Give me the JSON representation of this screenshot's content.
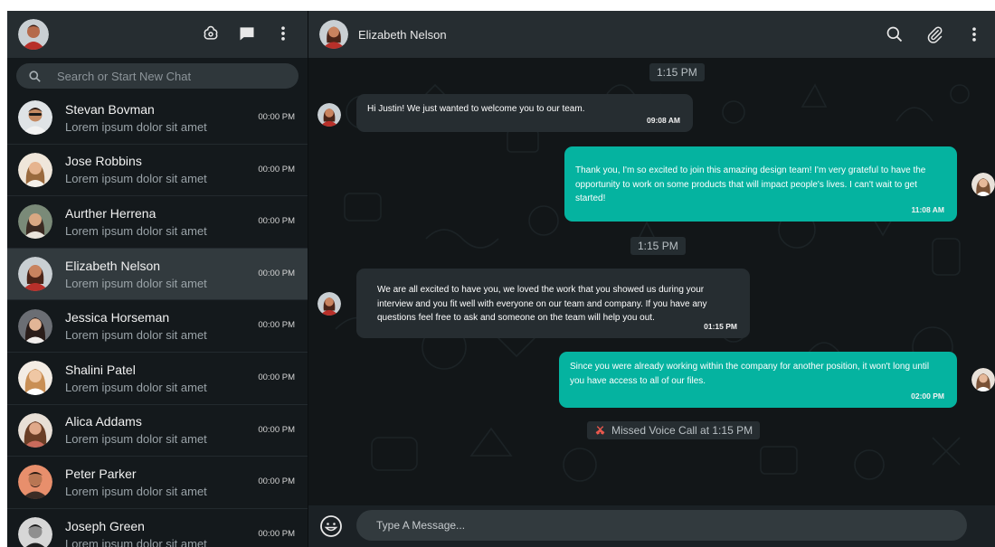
{
  "sidebar": {
    "search_placeholder": "Search or Start New Chat",
    "chats": [
      {
        "name": "Stevan Bovman",
        "preview": "Lorem ipsum dolor sit amet",
        "time": "00:00 PM"
      },
      {
        "name": "Jose Robbins",
        "preview": "Lorem ipsum dolor sit amet",
        "time": "00:00 PM"
      },
      {
        "name": "Aurther Herrena",
        "preview": "Lorem ipsum dolor sit amet",
        "time": "00:00 PM"
      },
      {
        "name": "Elizabeth Nelson",
        "preview": "Lorem ipsum dolor sit amet",
        "time": "00:00 PM"
      },
      {
        "name": "Jessica Horseman",
        "preview": "Lorem ipsum dolor sit amet",
        "time": "00:00 PM"
      },
      {
        "name": "Shalini Patel",
        "preview": "Lorem ipsum dolor sit amet",
        "time": "00:00 PM"
      },
      {
        "name": "Alica Addams",
        "preview": "Lorem ipsum dolor sit amet",
        "time": "00:00 PM"
      },
      {
        "name": "Peter Parker",
        "preview": "Lorem ipsum dolor sit amet",
        "time": "00:00 PM"
      },
      {
        "name": "Joseph Green",
        "preview": "Lorem ipsum dolor sit amet",
        "time": "00:00 PM"
      }
    ],
    "active_index": 3,
    "icons": [
      "status-icon",
      "chat-icon",
      "more-vertical-icon"
    ]
  },
  "conversation": {
    "contact_name": "Elizabeth Nelson",
    "icons": [
      "search-icon",
      "attach-icon",
      "more-vertical-icon"
    ],
    "messages": [
      {
        "type": "date",
        "text": "1:15 PM"
      },
      {
        "type": "in",
        "text": "Hi Justin! We just wanted to welcome you to our team.",
        "time": "09:08 AM"
      },
      {
        "type": "out",
        "text": "Thank you, I'm so excited to join this amazing design team! I'm very grateful to have the opportunity to work on some products that will impact people's lives. I can't wait to get started!",
        "time": "11:08 AM"
      },
      {
        "type": "date",
        "text": "1:15 PM"
      },
      {
        "type": "in",
        "text": "We are all excited to have you, we loved the work that you showed us during your interview and you fit well with everyone on our team and company. If you have any questions feel free to ask and someone on the team will help you out.",
        "time": "01:15 PM"
      },
      {
        "type": "out",
        "text": "Since you were already working within the company for another position, it won't long until you have access to all of our files.",
        "time": "02:00 PM"
      },
      {
        "type": "missed",
        "text": "Missed Voice Call at 1:15 PM"
      }
    ],
    "composer_placeholder": "Type A Message..."
  },
  "colors": {
    "accent_bubble": "#05b3a0",
    "incoming_bubble": "#262d31",
    "header_bg": "#262d31",
    "background": "#121618",
    "missed_call_icon": "#e8584d"
  }
}
